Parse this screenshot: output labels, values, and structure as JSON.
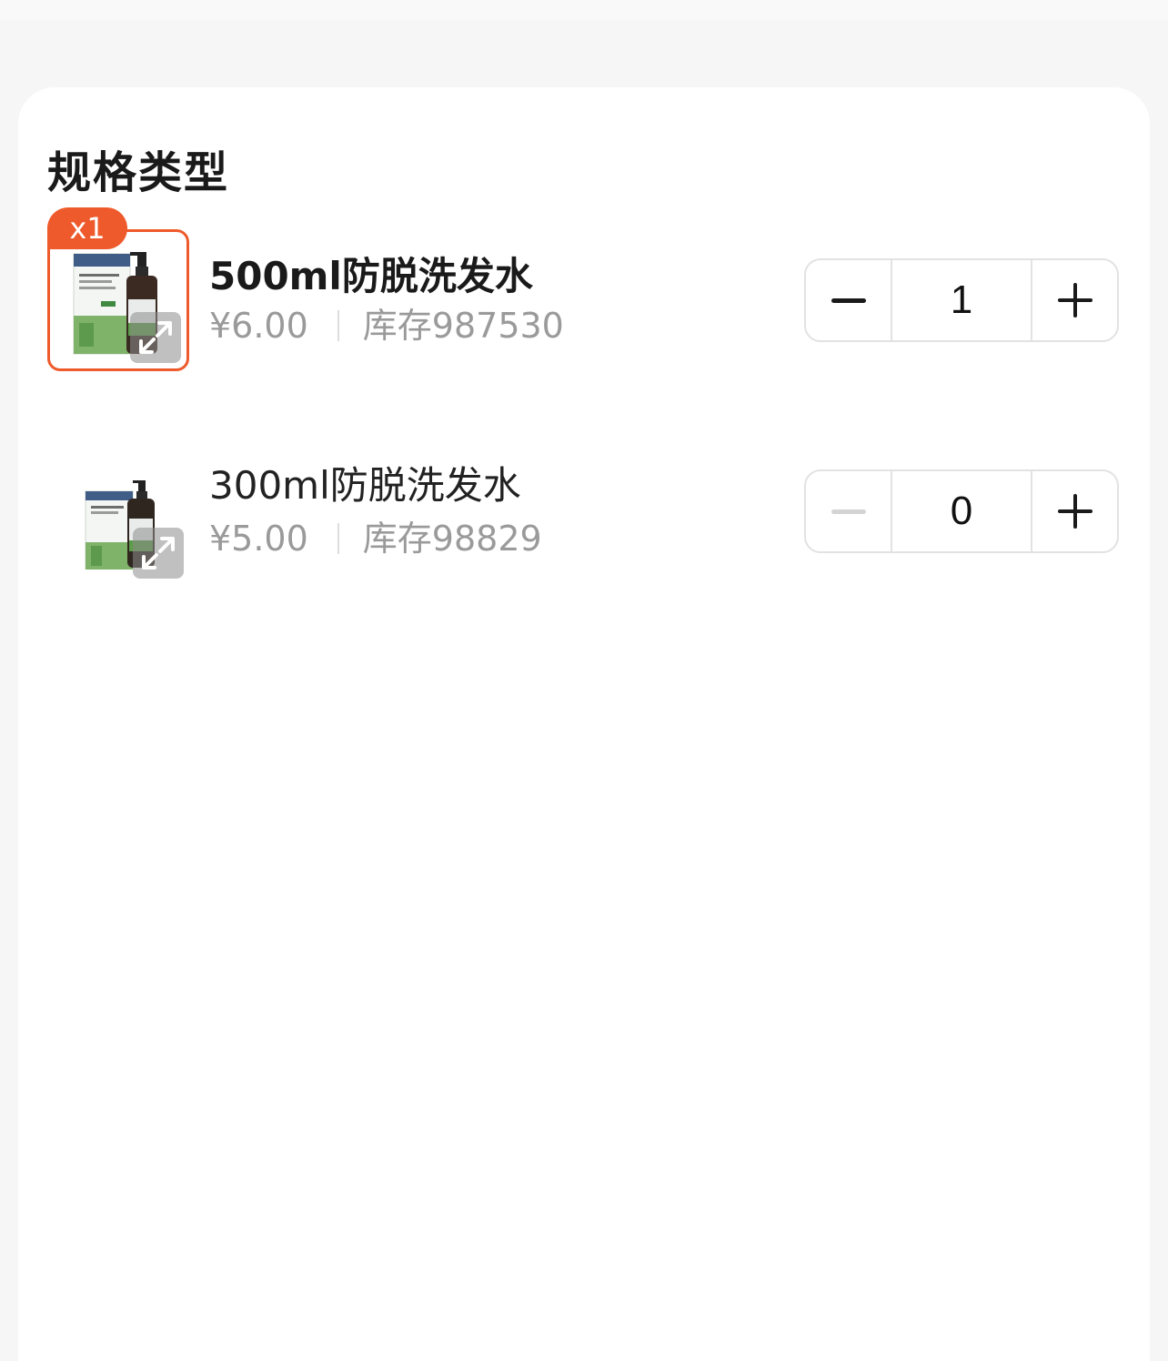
{
  "section": {
    "title": "规格类型"
  },
  "skus": [
    {
      "name": "500ml防脱洗发水",
      "price": "¥6.00",
      "stock": "库存987530",
      "quantity": "1",
      "badge": "x1",
      "selected": true
    },
    {
      "name": "300ml防脱洗发水",
      "price": "¥5.00",
      "stock": "库存98829",
      "quantity": "0",
      "selected": false
    }
  ],
  "colors": {
    "accent": "#ee5a2b",
    "price_gray": "#9a9a9a",
    "border": "#e2e2e2"
  },
  "icons": {
    "expand": "expand-arrows-icon",
    "minus": "minus-icon",
    "plus": "plus-icon"
  }
}
